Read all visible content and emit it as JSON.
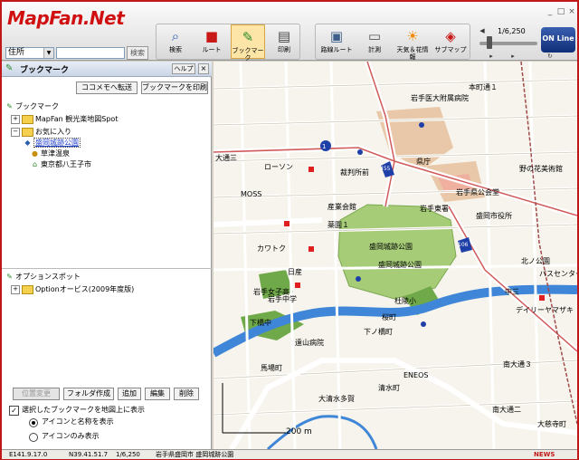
{
  "app": {
    "logo_text": "MapFan.Net",
    "brand_color": "#d01010"
  },
  "search": {
    "type_value": "住所",
    "input_value": "",
    "button_label": "検索"
  },
  "toolbar": {
    "main": [
      {
        "label": "検索",
        "icon": "magnifier-icon"
      },
      {
        "label": "ルート",
        "icon": "car-icon"
      },
      {
        "label": "ブックマーク",
        "icon": "bookmark-icon",
        "active": true
      },
      {
        "label": "印刷",
        "icon": "printer-icon"
      }
    ],
    "sub": [
      {
        "label": "路線ルート",
        "icon": "train-route-icon"
      },
      {
        "label": "計測",
        "icon": "ruler-icon"
      },
      {
        "label": "天気＆花情報",
        "icon": "weather-icon"
      },
      {
        "label": "サブマップ",
        "icon": "submap-icon"
      }
    ],
    "scale": "1/6,250",
    "online_label": "ON Line"
  },
  "panel": {
    "title": "ブックマーク",
    "help_label": "ヘルプ",
    "transfer_label": "ココメモへ転送",
    "print_label": "ブックマークを印刷",
    "tree": [
      {
        "label": "ブックマーク",
        "level": 0,
        "kind": "root"
      },
      {
        "label": "MapFan 観光楽地図Spot",
        "level": 1,
        "kind": "folder",
        "toggle": "+"
      },
      {
        "label": "お気に入り",
        "level": 1,
        "kind": "folder",
        "toggle": "-"
      },
      {
        "label": "盛岡城跡公園",
        "level": 2,
        "kind": "pin",
        "selected": true
      },
      {
        "label": "草津温泉",
        "level": 2,
        "kind": "pin"
      },
      {
        "label": "東京都八王子市",
        "level": 2,
        "kind": "pin"
      }
    ],
    "option_tree": [
      {
        "label": "オプションスポット",
        "level": 0,
        "kind": "root"
      },
      {
        "label": "Optionオービス(2009年度版)",
        "level": 1,
        "kind": "folder",
        "toggle": "+"
      }
    ],
    "bottom_buttons": [
      {
        "label": "位置変更",
        "disabled": true
      },
      {
        "label": "フォルダ作成"
      },
      {
        "label": "追加"
      },
      {
        "label": "編集"
      },
      {
        "label": "削除"
      }
    ],
    "show_on_map_label": "選択したブックマークを地図上に表示",
    "show_on_map_checked": true,
    "radio_icon_name": "アイコンと名称を表示",
    "radio_icon_only": "アイコンのみ表示"
  },
  "map": {
    "labels": {
      "hospital": "岩手医大附属病院",
      "honcho": "本町通１",
      "omichi3": "大通三",
      "lawson": "ローソン",
      "court": "裁判所前",
      "pref_office": "県庁",
      "nonohana": "野の花美術館",
      "moss": "MOSS",
      "sangyo": "産業会館",
      "pref_hall": "岩手県公会堂",
      "iwate_bank": "岩手東署",
      "city_office": "盛岡市役所",
      "yakuen": "薬園１",
      "kawatoku": "カワトク",
      "park": "盛岡城跡公園",
      "park2": "盛岡城跡公園",
      "nisshin": "日産",
      "iwate_univ": "岩手女子高",
      "bus_center": "バスセンター",
      "naka3": "中三",
      "daily": "デイリーヤマザキ",
      "shimohashi": "下橋中",
      "tohoku": "杜陵小",
      "sakura": "桜町",
      "tooyama": "遠山病院",
      "shimonohashi": "下ノ橋町",
      "baba": "馬場町",
      "eneos": "ENEOS",
      "minamiodori3": "南大通３",
      "minamiodori2": "南大通二",
      "oshimizu": "大清水多賀",
      "shimizu": "清水町",
      "hokkokuen": "北ノ公園",
      "daitomachi": "大慈寺町",
      "route1": "1",
      "route455": "455",
      "route106": "106",
      "ekimae": "岩手中学",
      "scale_label": "200 m"
    }
  },
  "status": {
    "coord_e": "E141.9.17.0",
    "coord_n": "N39.41.51.7",
    "scale": "1/6,250",
    "address": "岩手県盛岡市 盛岡城跡公園",
    "news": "NEWS"
  }
}
